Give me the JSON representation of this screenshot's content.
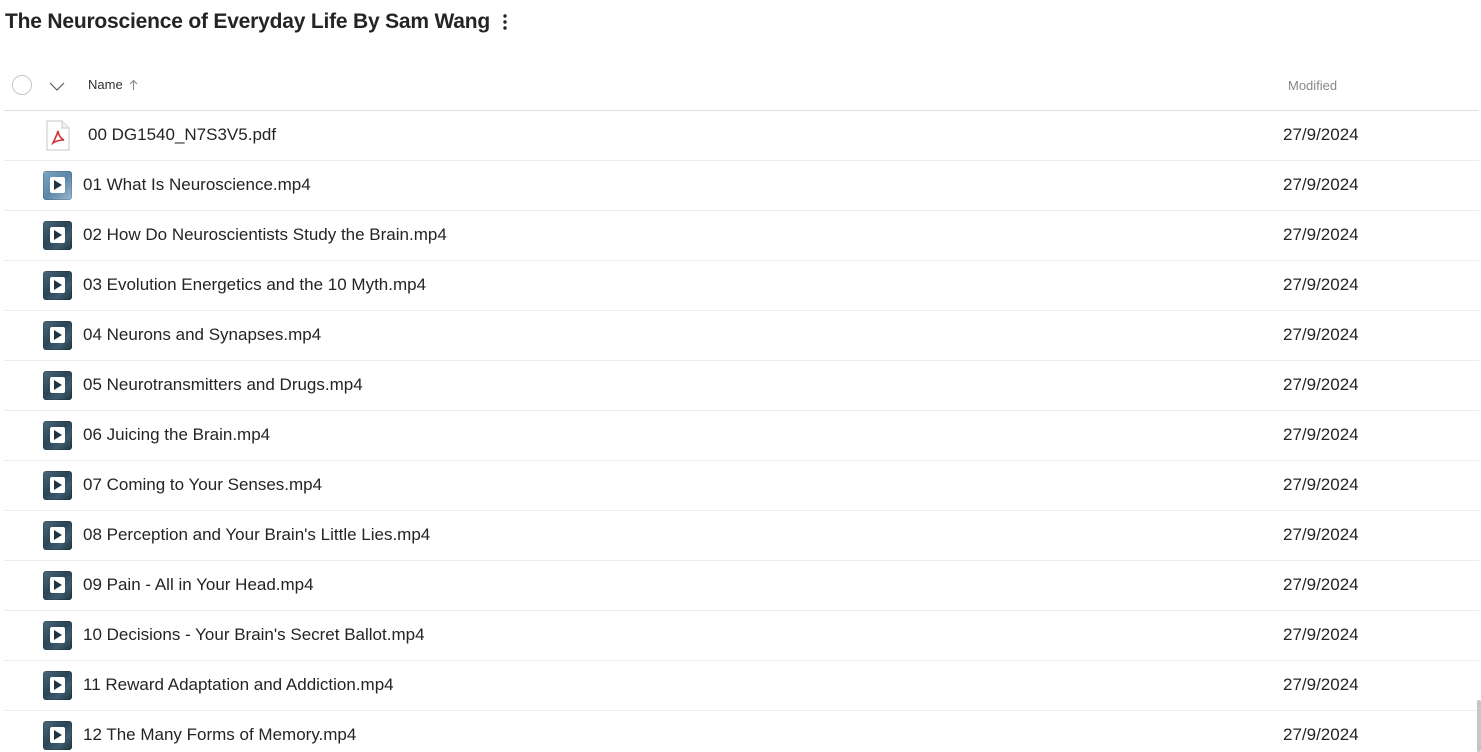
{
  "folder": {
    "title": "The Neuroscience of Everyday Life By Sam Wang"
  },
  "columns": {
    "name": "Name",
    "modified": "Modified"
  },
  "files": [
    {
      "name": "00 DG1540_N7S3V5.pdf",
      "modified": "27/9/2024",
      "type": "pdf"
    },
    {
      "name": "01 What Is Neuroscience.mp4",
      "modified": "27/9/2024",
      "type": "video"
    },
    {
      "name": "02 How Do Neuroscientists Study the Brain.mp4",
      "modified": "27/9/2024",
      "type": "video"
    },
    {
      "name": "03 Evolution Energetics and the 10 Myth.mp4",
      "modified": "27/9/2024",
      "type": "video"
    },
    {
      "name": "04 Neurons and Synapses.mp4",
      "modified": "27/9/2024",
      "type": "video"
    },
    {
      "name": "05 Neurotransmitters and Drugs.mp4",
      "modified": "27/9/2024",
      "type": "video"
    },
    {
      "name": "06 Juicing the Brain.mp4",
      "modified": "27/9/2024",
      "type": "video"
    },
    {
      "name": "07 Coming to Your Senses.mp4",
      "modified": "27/9/2024",
      "type": "video"
    },
    {
      "name": "08 Perception and Your Brain's Little Lies.mp4",
      "modified": "27/9/2024",
      "type": "video"
    },
    {
      "name": "09 Pain - All in Your Head.mp4",
      "modified": "27/9/2024",
      "type": "video"
    },
    {
      "name": "10 Decisions - Your Brain's Secret Ballot.mp4",
      "modified": "27/9/2024",
      "type": "video"
    },
    {
      "name": "11 Reward Adaptation and Addiction.mp4",
      "modified": "27/9/2024",
      "type": "video"
    },
    {
      "name": "12 The Many Forms of Memory.mp4",
      "modified": "27/9/2024",
      "type": "video"
    }
  ],
  "icons": {
    "more": "more-vertical-icon",
    "select": "select-all-circle-icon",
    "expand": "chevron-down-icon",
    "sort": "sort-ascending-arrow-icon",
    "pdf": "pdf-file-icon",
    "video": "video-file-icon"
  },
  "colors": {
    "text": "#242424",
    "muted": "#8a8886",
    "divider": "#edebe9",
    "pdf_red": "#d13438"
  }
}
